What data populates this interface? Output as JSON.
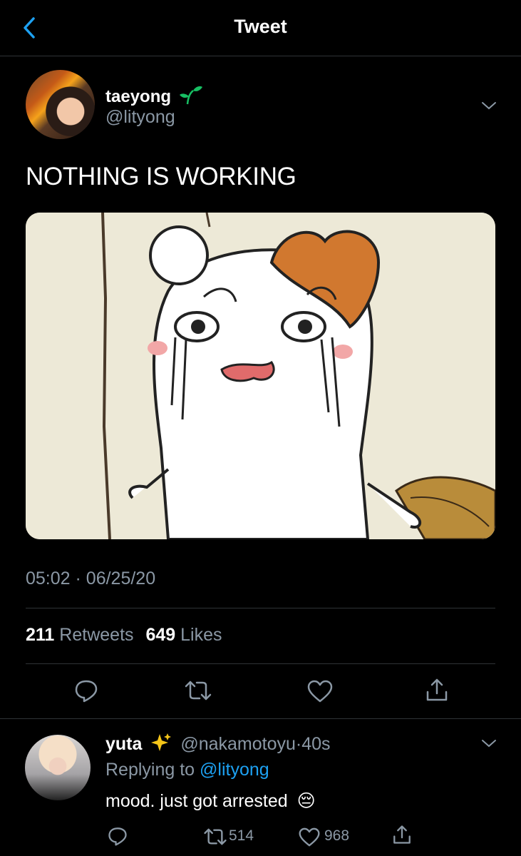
{
  "header": {
    "title": "Tweet"
  },
  "tweet": {
    "name": "taeyong",
    "handle": "@lityong",
    "text": "NOTHING IS WORKING",
    "time": "05:02",
    "separator": "·",
    "date": "06/25/20",
    "retweet_count": "211",
    "retweets_label": "Retweets",
    "like_count": "649",
    "likes_label": "Likes"
  },
  "reply": {
    "name": "yuta",
    "handle": "@nakamotoyu",
    "separator": "·",
    "time": "40s",
    "replying_prefix": "Replying to",
    "replying_handle": "@lityong",
    "text": "mood. just got arrested",
    "emoji": "😔",
    "retweet_count": "514",
    "like_count": "968"
  },
  "colors": {
    "accent": "#1da1f2",
    "muted": "#8b98a5",
    "leaf": "#17bf63"
  },
  "icons": {
    "back": "chevron-left-icon",
    "more": "chevron-down-icon",
    "reply": "speech-bubble-icon",
    "retweet": "retweet-icon",
    "like": "heart-icon",
    "share": "share-icon",
    "sprout": "sprout-icon",
    "sparkles": "sparkles-icon"
  }
}
